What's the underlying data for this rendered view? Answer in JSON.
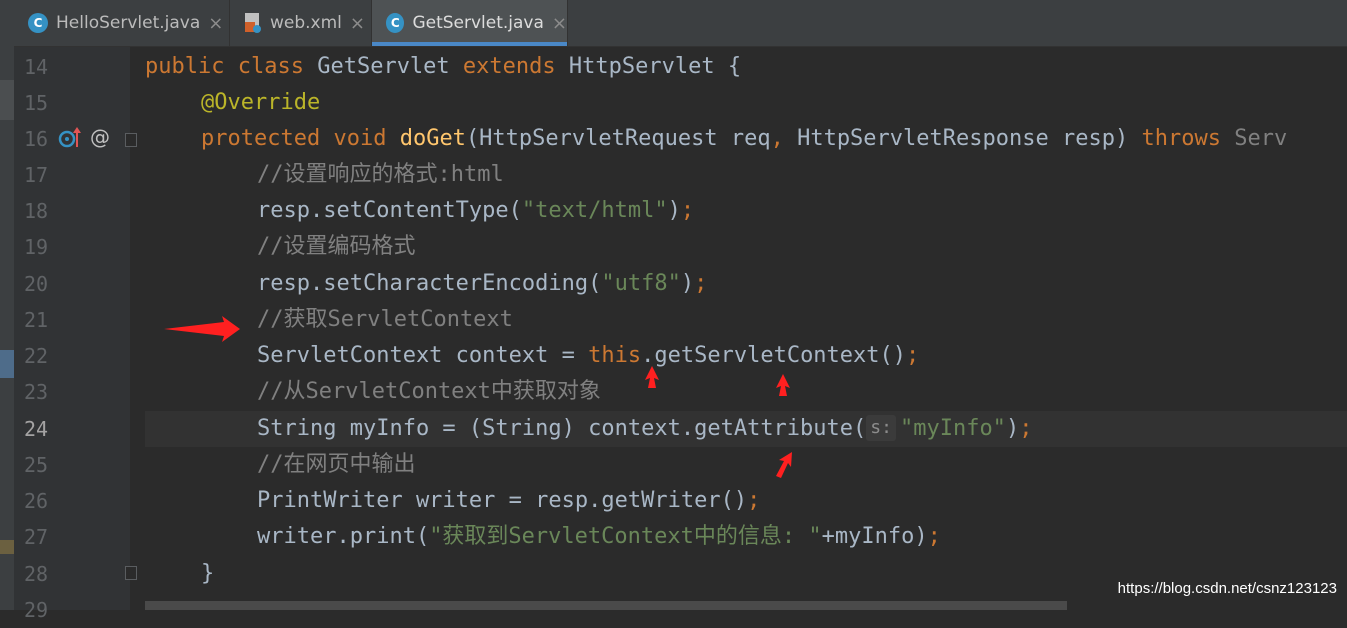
{
  "tabs": [
    {
      "label": "HelloServlet.java",
      "icon": "java-class-icon",
      "active": false
    },
    {
      "label": "web.xml",
      "icon": "xml-file-icon",
      "active": false
    },
    {
      "label": "GetServlet.java",
      "icon": "java-class-icon",
      "active": true
    }
  ],
  "editor": {
    "current_line": "24",
    "line_numbers": [
      "14",
      "15",
      "16",
      "17",
      "18",
      "19",
      "20",
      "21",
      "22",
      "23",
      "24",
      "25",
      "26",
      "27",
      "28",
      "29"
    ],
    "lines": {
      "l14": [
        "public",
        "class",
        "GetServlet",
        "extends",
        "HttpServlet",
        "{"
      ],
      "l15": "@Override",
      "l16": [
        "protected",
        "void",
        "doGet",
        "(HttpServletRequest req",
        ",",
        "HttpServletResponse resp)",
        "throws",
        "Serv"
      ],
      "l17": "//设置响应的格式:html",
      "l18": [
        "resp.setContentType(",
        "\"text/html\"",
        ")",
        ";"
      ],
      "l19": "//设置编码格式",
      "l20": [
        "resp.setCharacterEncoding(",
        "\"utf8\"",
        ")",
        ";"
      ],
      "l21": "//获取ServletContext",
      "l22": [
        "ServletContext context = ",
        "this",
        ".getServletContext()",
        ";"
      ],
      "l23": "//从ServletContext中获取对象",
      "l24": [
        "String myInfo = (String) context.getAttribute(",
        "s:",
        "\"myInfo\"",
        ")",
        ";"
      ],
      "l25": "//在网页中输出",
      "l26": [
        "PrintWriter writer = resp.getWriter()",
        ";"
      ],
      "l27": [
        "writer.print(",
        "\"获取到ServletContext中的信息: \"",
        "+myInfo)",
        ";"
      ],
      "l28": "}"
    }
  },
  "gutter_icons": [
    "override-method-icon",
    "at-annotation-icon"
  ],
  "watermark": "https://blog.csdn.net/csnz123123",
  "colors": {
    "background": "#2b2b2b",
    "keyword": "#cc7832",
    "string": "#6a8759",
    "comment": "#808080",
    "method": "#ffc66d",
    "annotation": "#bbb529",
    "arrow": "#ff2020"
  }
}
